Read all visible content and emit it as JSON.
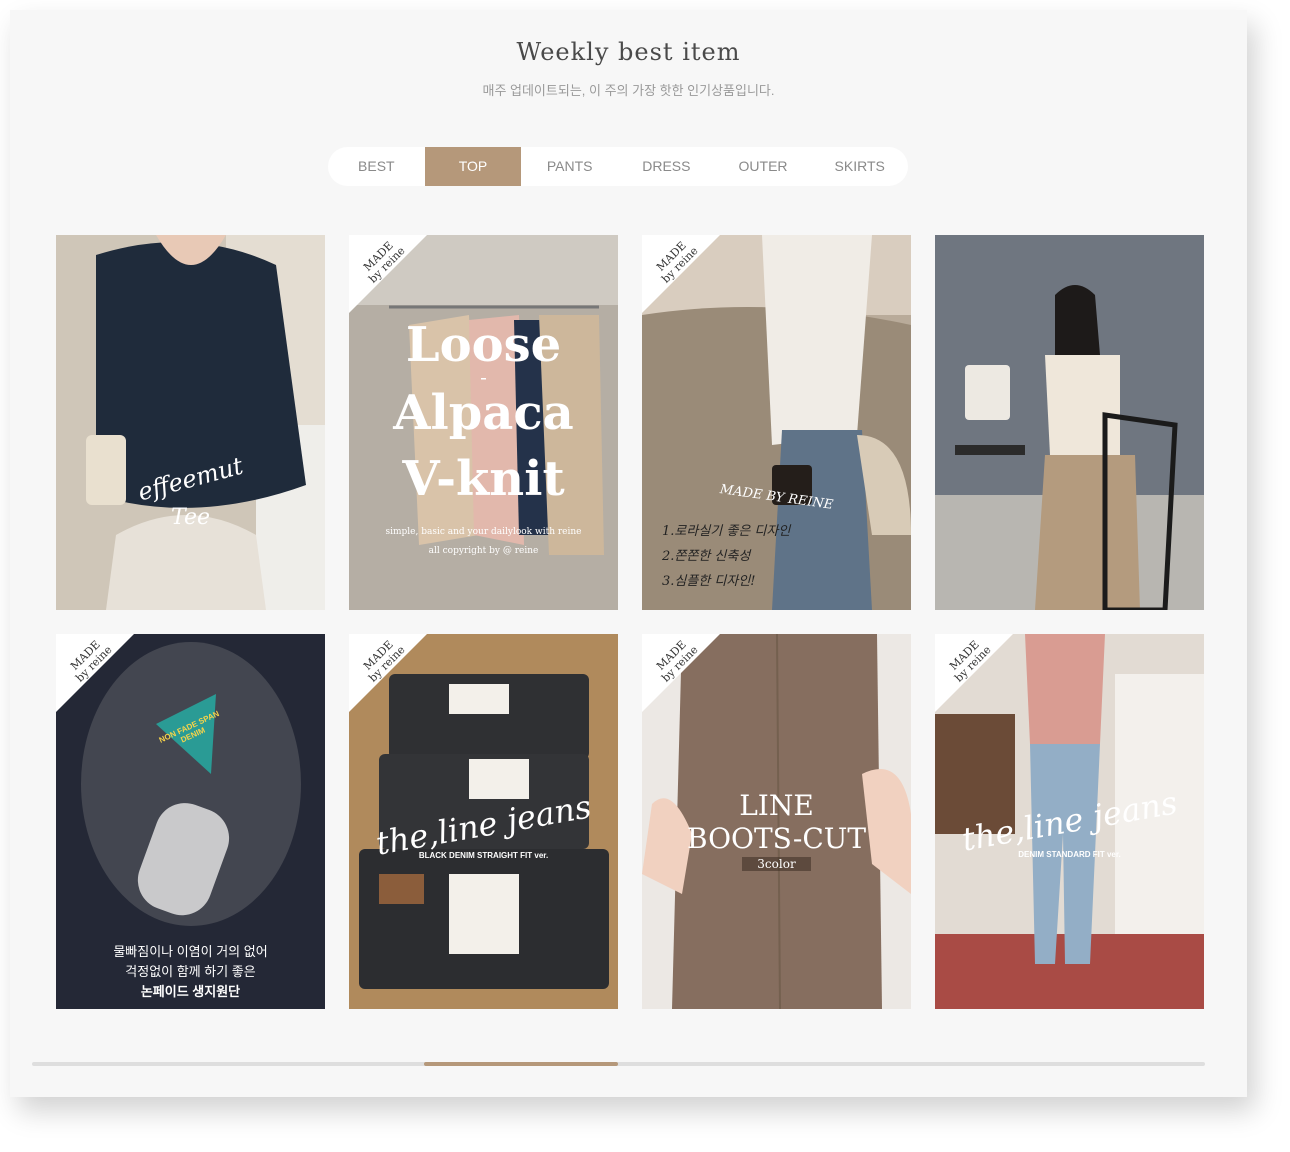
{
  "section": {
    "title": "Weekly best item",
    "subtitle": "매주 업데이트되는, 이 주의 가장 핫한 인기상품입니다."
  },
  "tabs": [
    {
      "label": "BEST",
      "active": false
    },
    {
      "label": "TOP",
      "active": true
    },
    {
      "label": "PANTS",
      "active": false
    },
    {
      "label": "DRESS",
      "active": false
    },
    {
      "label": "OUTER",
      "active": false
    },
    {
      "label": "SKIRTS",
      "active": false
    }
  ],
  "ribbon": {
    "line1": "MADE",
    "line2": "by reine"
  },
  "products": [
    {
      "image": "woman-navy-cowl-top",
      "overlay": {
        "script": "effeemut",
        "script2": "Tee"
      }
    },
    {
      "image": "alpaca-knit-rack",
      "overlay": {
        "line1": "Loose",
        "line2": "-",
        "line3": "Alpaca",
        "line4": "V-knit",
        "small1": "simple, basic and your dailylook with reine",
        "small2": "all copyright by @ reine"
      }
    },
    {
      "image": "woman-beach-knit",
      "overlay": {
        "hand1": "MADE BY REINE",
        "hand2": "1.로라실기 좋은 디자인",
        "hand3": "2.쫀쫀한 신축성",
        "hand4": "3.심플한 디자인!"
      }
    },
    {
      "image": "woman-cafe-beige-skirt",
      "overlay": {}
    },
    {
      "image": "black-denim-nonfade",
      "overlay": {
        "tag": "NON FADE SPAN DENIM",
        "kr1": "물빠짐이나 이염이 거의 없어",
        "kr2": "걱정없이 함께 하기 좋은",
        "kr3": "논페이드 생지원단"
      }
    },
    {
      "image": "folded-black-jeans",
      "overlay": {
        "script": "the,line jeans",
        "small": "BLACK DENIM STRAIGHT FIT ver."
      }
    },
    {
      "image": "brown-bootcut-pants",
      "overlay": {
        "line1": "LINE",
        "line2": "BOOTS-CUT",
        "small": "3color"
      }
    },
    {
      "image": "woman-light-jeans",
      "overlay": {
        "script": "the,line jeans",
        "small": "DENIM STANDARD FIT ver."
      }
    }
  ],
  "colors": {
    "accent": "#b5987a",
    "panel_bg": "#f7f7f7",
    "title": "#4a4a4a"
  }
}
